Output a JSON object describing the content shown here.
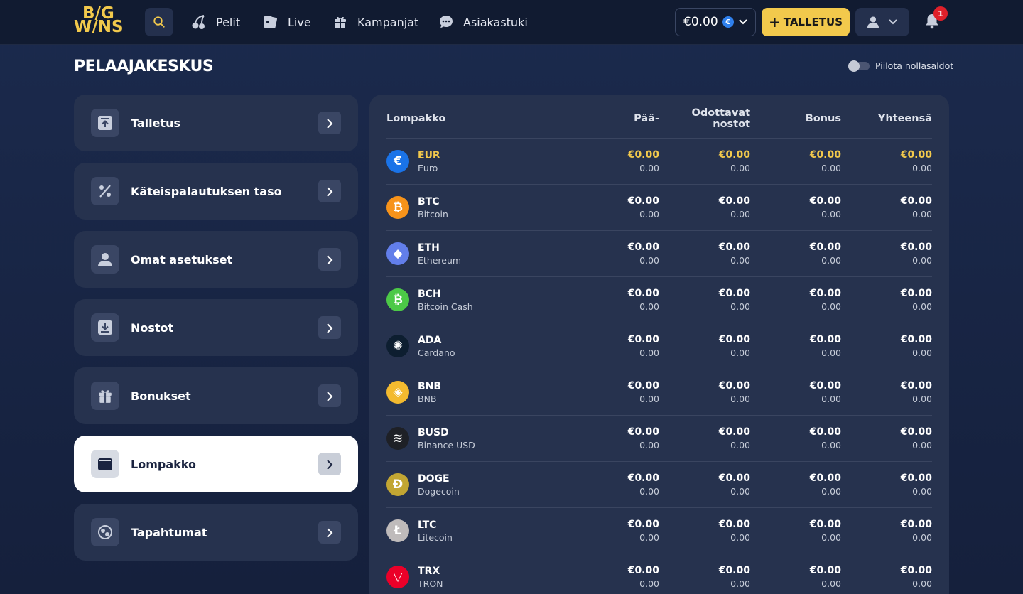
{
  "brand": {
    "logo_line1": "B/G",
    "logo_line2": "W/NS"
  },
  "nav": [
    {
      "label": "Pelit",
      "icon": "cherries-icon"
    },
    {
      "label": "Live",
      "icon": "cards-icon"
    },
    {
      "label": "Kampanjat",
      "icon": "gift-icon"
    },
    {
      "label": "Asiakastuki",
      "icon": "chat-icon"
    }
  ],
  "header": {
    "balance": "€0.00",
    "currency_badge": "€",
    "deposit_label": "TALLETUS",
    "notification_count": "1"
  },
  "page": {
    "title": "PELAAJAKESKUS",
    "hide_zero_label": "Piilota nollasaldot"
  },
  "menu": [
    {
      "label": "Talletus",
      "icon": "deposit-icon"
    },
    {
      "label": "Käteispalautuksen taso",
      "icon": "percent-icon"
    },
    {
      "label": "Omat asetukset",
      "icon": "user-icon"
    },
    {
      "label": "Nostot",
      "icon": "withdraw-icon"
    },
    {
      "label": "Bonukset",
      "icon": "gift-icon"
    },
    {
      "label": "Lompakko",
      "icon": "wallet-icon",
      "active": true
    },
    {
      "label": "Tapahtumat",
      "icon": "transactions-icon"
    }
  ],
  "wallet": {
    "columns": {
      "name": "Lompakko",
      "main": "Pää-",
      "pending": "Odottavat nostot",
      "bonus": "Bonus",
      "total": "Yhteensä"
    },
    "rows": [
      {
        "code": "EUR",
        "name": "Euro",
        "color": "#1a73e8",
        "glyph": "€",
        "main": "€0.00",
        "main_sub": "0.00",
        "pending": "€0.00",
        "pending_sub": "0.00",
        "bonus": "€0.00",
        "bonus_sub": "0.00",
        "total": "€0.00",
        "total_sub": "0.00"
      },
      {
        "code": "BTC",
        "name": "Bitcoin",
        "color": "#f7931a",
        "glyph": "₿",
        "main": "€0.00",
        "main_sub": "0.00",
        "pending": "€0.00",
        "pending_sub": "0.00",
        "bonus": "€0.00",
        "bonus_sub": "0.00",
        "total": "€0.00",
        "total_sub": "0.00"
      },
      {
        "code": "ETH",
        "name": "Ethereum",
        "color": "#627eea",
        "glyph": "◆",
        "main": "€0.00",
        "main_sub": "0.00",
        "pending": "€0.00",
        "pending_sub": "0.00",
        "bonus": "€0.00",
        "bonus_sub": "0.00",
        "total": "€0.00",
        "total_sub": "0.00"
      },
      {
        "code": "BCH",
        "name": "Bitcoin Cash",
        "color": "#4cc947",
        "glyph": "₿",
        "main": "€0.00",
        "main_sub": "0.00",
        "pending": "€0.00",
        "pending_sub": "0.00",
        "bonus": "€0.00",
        "bonus_sub": "0.00",
        "total": "€0.00",
        "total_sub": "0.00"
      },
      {
        "code": "ADA",
        "name": "Cardano",
        "color": "#0d1e30",
        "glyph": "✺",
        "main": "€0.00",
        "main_sub": "0.00",
        "pending": "€0.00",
        "pending_sub": "0.00",
        "bonus": "€0.00",
        "bonus_sub": "0.00",
        "total": "€0.00",
        "total_sub": "0.00"
      },
      {
        "code": "BNB",
        "name": "BNB",
        "color": "#f3ba2f",
        "glyph": "◈",
        "main": "€0.00",
        "main_sub": "0.00",
        "pending": "€0.00",
        "pending_sub": "0.00",
        "bonus": "€0.00",
        "bonus_sub": "0.00",
        "total": "€0.00",
        "total_sub": "0.00"
      },
      {
        "code": "BUSD",
        "name": "Binance USD",
        "color": "#1e2026",
        "glyph": "≋",
        "main": "€0.00",
        "main_sub": "0.00",
        "pending": "€0.00",
        "pending_sub": "0.00",
        "bonus": "€0.00",
        "bonus_sub": "0.00",
        "total": "€0.00",
        "total_sub": "0.00"
      },
      {
        "code": "DOGE",
        "name": "Dogecoin",
        "color": "#c2a633",
        "glyph": "Ð",
        "main": "€0.00",
        "main_sub": "0.00",
        "pending": "€0.00",
        "pending_sub": "0.00",
        "bonus": "€0.00",
        "bonus_sub": "0.00",
        "total": "€0.00",
        "total_sub": "0.00"
      },
      {
        "code": "LTC",
        "name": "Litecoin",
        "color": "#bfbbbb",
        "glyph": "Ł",
        "main": "€0.00",
        "main_sub": "0.00",
        "pending": "€0.00",
        "pending_sub": "0.00",
        "bonus": "€0.00",
        "bonus_sub": "0.00",
        "total": "€0.00",
        "total_sub": "0.00"
      },
      {
        "code": "TRX",
        "name": "TRON",
        "color": "#eb0029",
        "glyph": "▽",
        "main": "€0.00",
        "main_sub": "0.00",
        "pending": "€0.00",
        "pending_sub": "0.00",
        "bonus": "€0.00",
        "bonus_sub": "0.00",
        "total": "€0.00",
        "total_sub": "0.00"
      }
    ]
  },
  "colors": {
    "accent": "#f2c94c",
    "background": "#1b2a4d",
    "card": "#26324e",
    "badge": "#e0202a"
  }
}
